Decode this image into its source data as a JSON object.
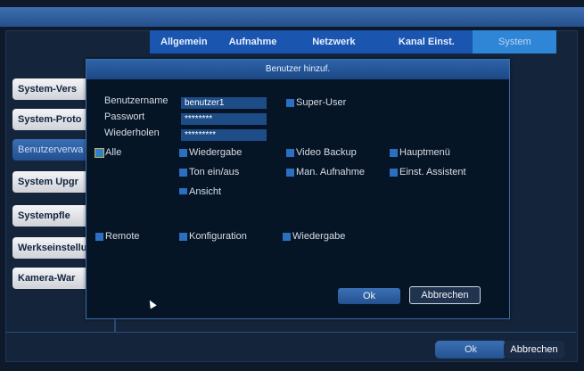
{
  "tabs": [
    "Allgemein",
    "Aufnahme",
    "Netzwerk",
    "Kanal Einst.",
    "System"
  ],
  "sidebar": {
    "items": [
      {
        "label": "System-Vers"
      },
      {
        "label": "System-Proto"
      },
      {
        "label": "Benutzerverwa"
      },
      {
        "label": "System Upgr"
      },
      {
        "label": "Systempfle"
      },
      {
        "label": "Werkseinstellu"
      },
      {
        "label": "Kamera-War"
      }
    ]
  },
  "footer": {
    "ok": "Ok",
    "cancel": "Abbrechen"
  },
  "dialog": {
    "title": "Benutzer hinzuf.",
    "username_label": "Benutzername",
    "username_value": "benutzer1",
    "password_label": "Passwort",
    "password_value": "********",
    "repeat_label": "Wiederholen",
    "repeat_value": "*********",
    "superuser": "Super-User",
    "perms": {
      "alle": "Alle",
      "wiedergabe": "Wiedergabe",
      "video_backup": "Video Backup",
      "hauptmenu": "Hauptmenü",
      "ton": "Ton ein/aus",
      "man_aufnahme": "Man. Aufnahme",
      "einst_assistent": "Einst. Assistent",
      "ansicht": "Ansicht",
      "remote": "Remote",
      "konfiguration": "Konfiguration",
      "wiedergabe2": "Wiedergabe"
    },
    "ok": "Ok",
    "cancel": "Abbrechen"
  }
}
